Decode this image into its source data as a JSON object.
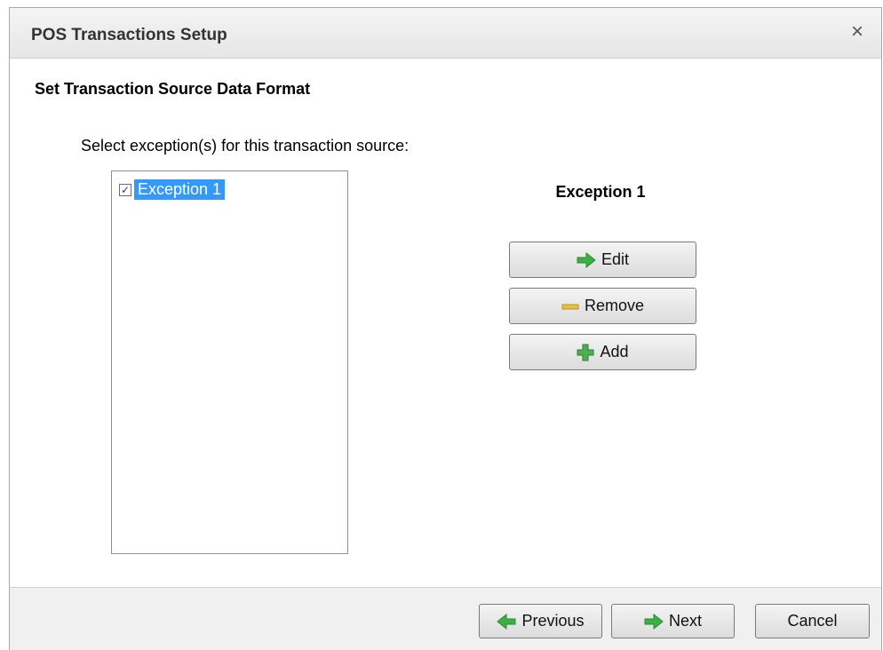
{
  "window": {
    "title": "POS Transactions Setup",
    "close_symbol": "×"
  },
  "section_title": "Set Transaction Source Data Format",
  "prompt": "Select exception(s) for this transaction source:",
  "exceptions": {
    "items": [
      {
        "label": "Exception 1",
        "checked": true,
        "selected": true
      }
    ]
  },
  "detail": {
    "title": "Exception 1",
    "edit_label": "Edit",
    "remove_label": "Remove",
    "add_label": "Add"
  },
  "footer": {
    "previous_label": "Previous",
    "next_label": "Next",
    "cancel_label": "Cancel"
  },
  "colors": {
    "selection": "#3399ff",
    "arrow_green": "#3cb043",
    "remove_yellow": "#e8c23a",
    "add_green": "#4caf50"
  },
  "icons": {
    "edit": "arrow-right-icon",
    "remove": "minus-icon",
    "add": "plus-icon",
    "previous": "arrow-left-icon",
    "next": "arrow-right-icon"
  }
}
